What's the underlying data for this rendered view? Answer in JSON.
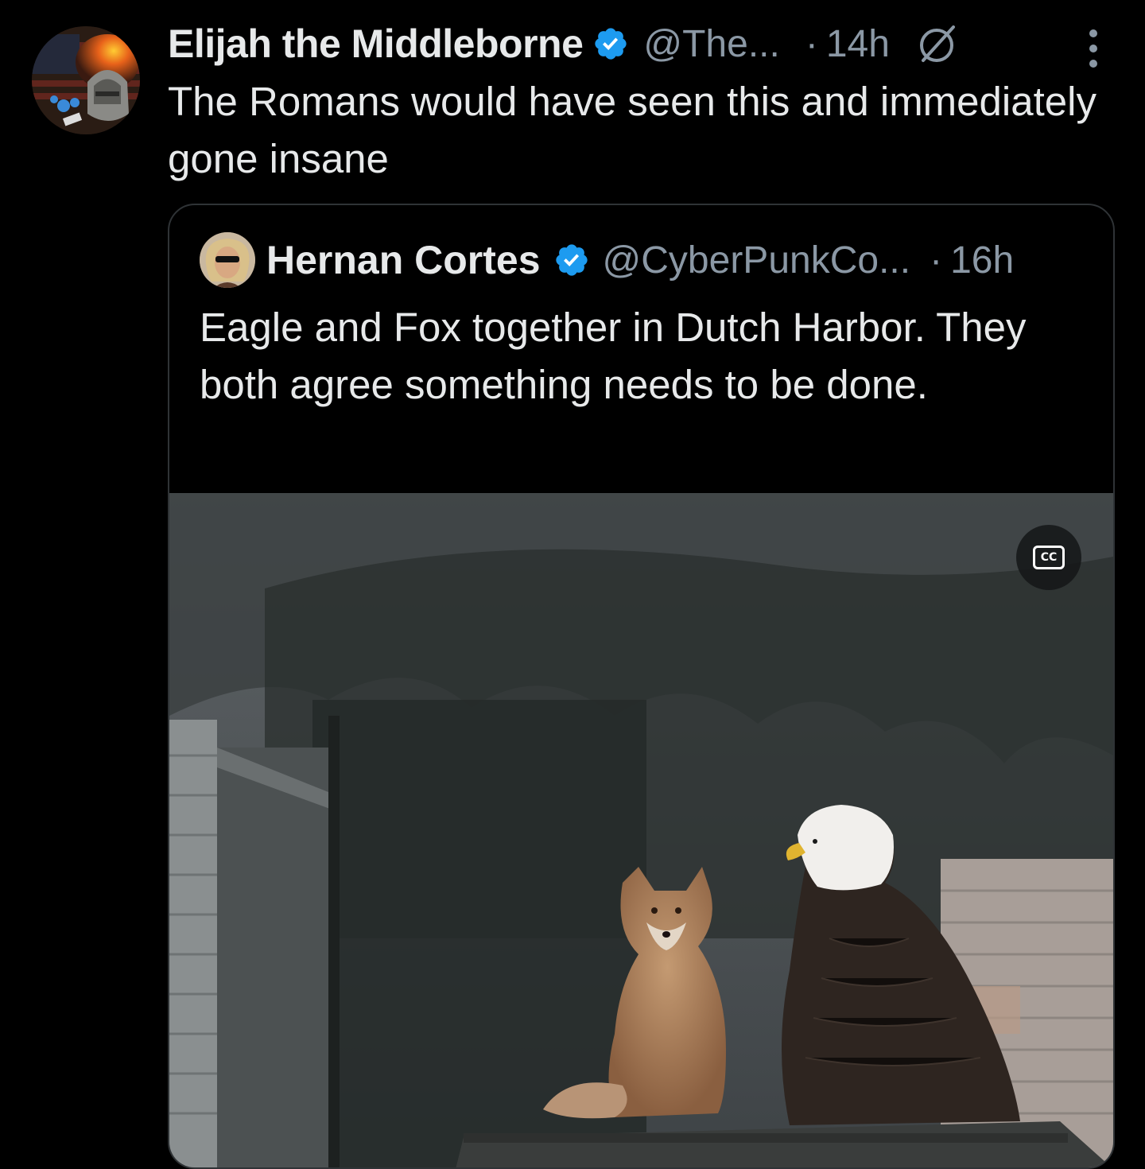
{
  "tweet": {
    "display_name": "Elijah the Middleborne",
    "handle": "@The...",
    "separator": "·",
    "time": "14h",
    "text": "The Romans would have seen this and immediately gone insane",
    "icons": {
      "verified": "verified-badge-icon",
      "grok": "grok-icon",
      "more": "more-options-icon"
    }
  },
  "quote": {
    "display_name": "Hernan Cortes",
    "handle": "@CyberPunkCo...",
    "separator": "·",
    "time": "16h",
    "text": "Eagle and Fox together in Dutch Harbor. They both agree something needs to be done.",
    "media": {
      "type": "video",
      "cc_label": "CC",
      "icon": "closed-captions-icon"
    }
  },
  "colors": {
    "background": "#000000",
    "text_primary": "#e7e9ea",
    "text_secondary": "#8b98a5",
    "verified_blue": "#1d9bf0",
    "border": "#2f3336"
  }
}
